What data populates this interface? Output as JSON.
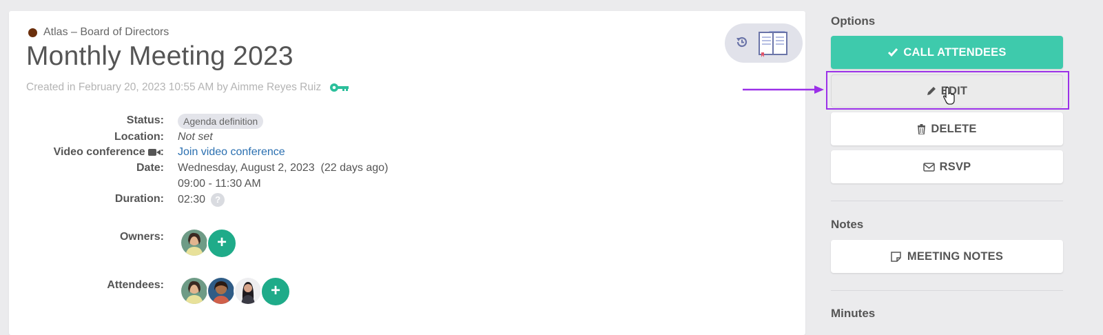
{
  "meeting": {
    "organization": "Atlas – Board of Directors",
    "title": "Monthly Meeting 2023",
    "created": "Created in February 20, 2023 10:55 AM by Aimme Reyes Ruiz"
  },
  "details": {
    "status_label": "Status:",
    "status_value": "Agenda definition",
    "location_label": "Location:",
    "location_value": "Not set",
    "video_label": "Video conference",
    "video_colon": ":",
    "video_value": "Join video conference",
    "date_label": "Date:",
    "date_value": "Wednesday, August 2, 2023  (22 days ago)",
    "time_value": "09:00 - 11:30 AM",
    "duration_label": "Duration:",
    "duration_value": "02:30",
    "help_glyph": "?",
    "owners_label": "Owners:",
    "attendees_label": "Attendees:",
    "add_glyph": "+"
  },
  "sidebar": {
    "options_title": "Options",
    "call_attendees": "CALL ATTENDEES",
    "edit": "EDIT",
    "delete": "DELETE",
    "rsvp": "RSVP",
    "notes_title": "Notes",
    "meeting_notes": "MEETING NOTES",
    "minutes_title": "Minutes"
  },
  "colors": {
    "accent_green": "#3ecaac",
    "add_button_green": "#1fab89",
    "highlight_purple": "#9b30e8",
    "link_blue": "#2a6fb0",
    "org_dot": "#6b2f0c"
  },
  "icons": [
    "history-icon",
    "book-icon",
    "key-icon",
    "video-camera-icon",
    "check-icon",
    "pencil-icon",
    "trash-icon",
    "envelope-icon",
    "note-icon",
    "help-icon",
    "plus-icon",
    "pointer-cursor-icon",
    "arrow-icon"
  ]
}
